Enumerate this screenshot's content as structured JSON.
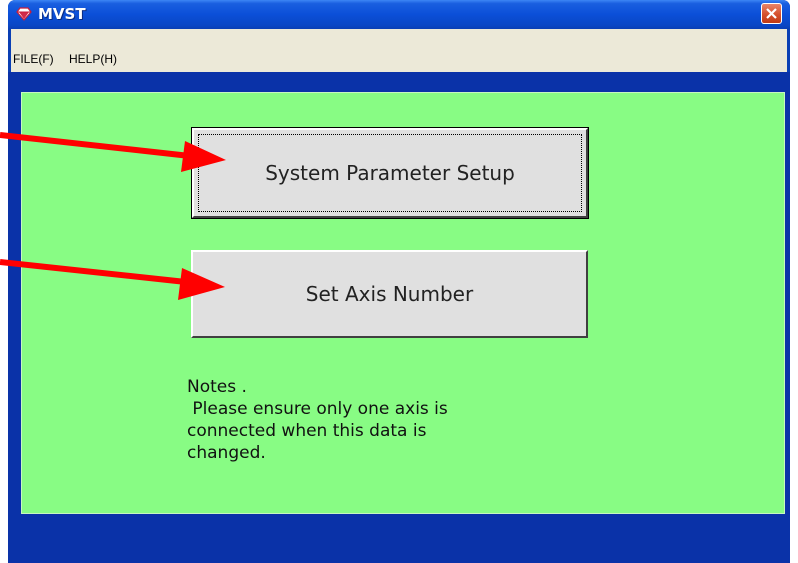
{
  "window": {
    "title": "MVST",
    "icons": {
      "app": "diamond-app-icon",
      "close": "close-icon"
    }
  },
  "menu": {
    "items": [
      {
        "label": "FILE(F)"
      },
      {
        "label": "HELP(H)"
      }
    ]
  },
  "buttons": {
    "system_parameter_setup": "System Parameter Setup",
    "set_axis_number": "Set Axis Number"
  },
  "notes": {
    "lines": [
      "Notes .",
      " Please ensure only one axis is",
      "connected when this data is",
      "changed."
    ]
  },
  "annotations": {
    "arrow_color": "#ff0000",
    "arrow_icons": [
      "arrow-to-system-parameter-setup",
      "arrow-to-set-axis-number"
    ]
  },
  "colors": {
    "panel_background": "#88fc84",
    "window_frame": "#0a32a8",
    "title_bar": "#0b4fd8",
    "menu_background": "#ece9d8",
    "button_face": "#e0e0e0"
  }
}
